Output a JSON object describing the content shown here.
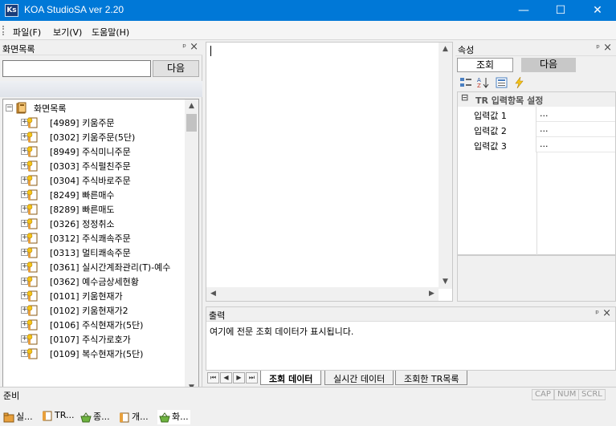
{
  "window": {
    "app_icon_text": "Ks",
    "title": "KOA StudioSA ver 2.20",
    "minimize": "—",
    "maximize": "☐",
    "close": "✕"
  },
  "menu": [
    "파일(F)",
    "보기(V)",
    "도움말(H)"
  ],
  "left_panel": {
    "title": "화면목록",
    "search_value": "",
    "next_label": "다음",
    "tree_root": "화면목록",
    "tree_items": [
      "[4989] 키움주문",
      "[0302] 키움주문(5단)",
      "[8949] 주식미니주문",
      "[0303] 주식펄친주문",
      "[0304] 주식바로주문",
      "[8249] 빠른매수",
      "[8289] 빠른매도",
      "[0326] 정정취소",
      "[0312] 주식쾌속주문",
      "[0313] 멀티쾌속주문",
      "[0361] 실시간계좌관리(T)-예수",
      "[0362] 예수금상세현황",
      "[0101] 키움현재가",
      "[0102] 키움현재가2",
      "[0106] 주식현재가(5단)",
      "[0107] 주식가로호가",
      "[0109] 복수현재가(5단)"
    ],
    "bottom_tabs": [
      "실...",
      "TR...",
      "종...",
      "개...",
      "화..."
    ]
  },
  "output": {
    "title": "출력",
    "text": "여기에 전문 조회 데이터가 표시됩니다.",
    "tabs": [
      "조회 데이터",
      "실시간 데이터",
      "조회한 TR목록"
    ]
  },
  "properties": {
    "title": "속성",
    "tab_query": "조회",
    "tab_next": "다음",
    "section": "TR 입력항목 설정",
    "rows": [
      {
        "name": "입력값 1",
        "value": "..."
      },
      {
        "name": "입력값 2",
        "value": "..."
      },
      {
        "name": "입력값 3",
        "value": "..."
      }
    ]
  },
  "status": {
    "text": "준비",
    "cap": "CAP",
    "num": "NUM",
    "scrl": "SCRL"
  },
  "colors": {
    "titlebar": "#0078d7",
    "tab_active": "#ffffff",
    "tab_inactive": "#c8c8c8"
  }
}
